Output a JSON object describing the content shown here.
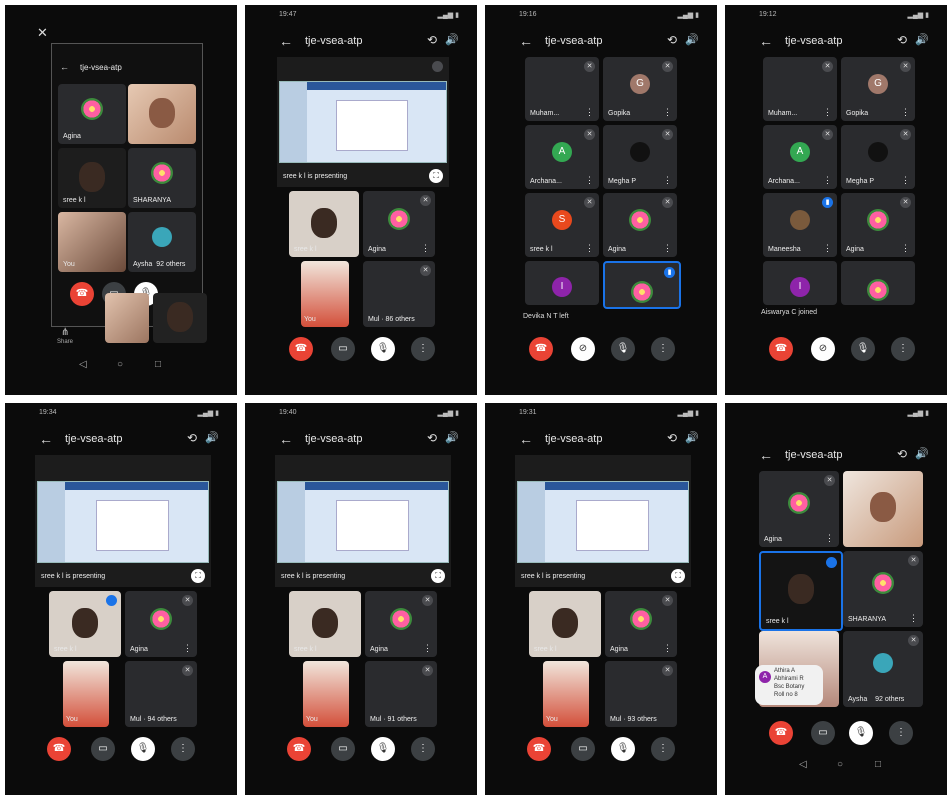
{
  "colors": {
    "end_call": "#ea4335",
    "active_speaker": "#1a73e8",
    "tile": "#2a2b2e"
  },
  "panels": [
    {
      "title": "tje-vsea-atp",
      "time": "",
      "close_label": "✕",
      "share_label": "Share",
      "tiles": [
        "Agina",
        "sree k l",
        "SHARANYA",
        "You",
        "Aysha",
        "92 others"
      ]
    },
    {
      "title": "tje-vsea-atp",
      "time": "19:47",
      "presenting": "sree k l is presenting",
      "tiles": [
        "sree k l",
        "Agina",
        "You",
        "Mul",
        "86 others"
      ]
    },
    {
      "title": "tje-vsea-atp",
      "time": "19:16",
      "tiles": [
        "Muham...",
        "Gopika",
        "Archana...",
        "Megha P",
        "sree k l",
        "Agina"
      ],
      "notice": "Devika N T left",
      "avatars": [
        "G",
        "A",
        "S",
        "I"
      ]
    },
    {
      "title": "tje-vsea-atp",
      "time": "19:12",
      "tiles": [
        "Muham...",
        "Gopika",
        "Archana...",
        "Megha P",
        "Maneesha",
        "Agina"
      ],
      "notice": "Aiswarya C joined",
      "avatars": [
        "G",
        "A",
        "I"
      ]
    },
    {
      "title": "tje-vsea-atp",
      "time": "19:34",
      "presenting": "sree k l is presenting",
      "tiles": [
        "sree k l",
        "Agina",
        "You",
        "Mul",
        "94 others"
      ]
    },
    {
      "title": "tje-vsea-atp",
      "time": "19:40",
      "presenting": "sree k l is presenting",
      "tiles": [
        "sree k l",
        "Agina",
        "You",
        "Mul",
        "91 others"
      ]
    },
    {
      "title": "tje-vsea-atp",
      "time": "19:31",
      "presenting": "sree k l is presenting",
      "tiles": [
        "sree k l",
        "Agina",
        "You",
        "Mul",
        "93 others"
      ]
    },
    {
      "title": "tje-vsea-atp",
      "time": "",
      "tiles": [
        "Agina",
        "sree k l",
        "SHARANYA",
        "Aysha",
        "92 others"
      ],
      "chat_initial": "A",
      "chat_lines": [
        "Athira A",
        "Abhirami R",
        "Bsc Botany",
        "Roll no 8"
      ]
    }
  ]
}
